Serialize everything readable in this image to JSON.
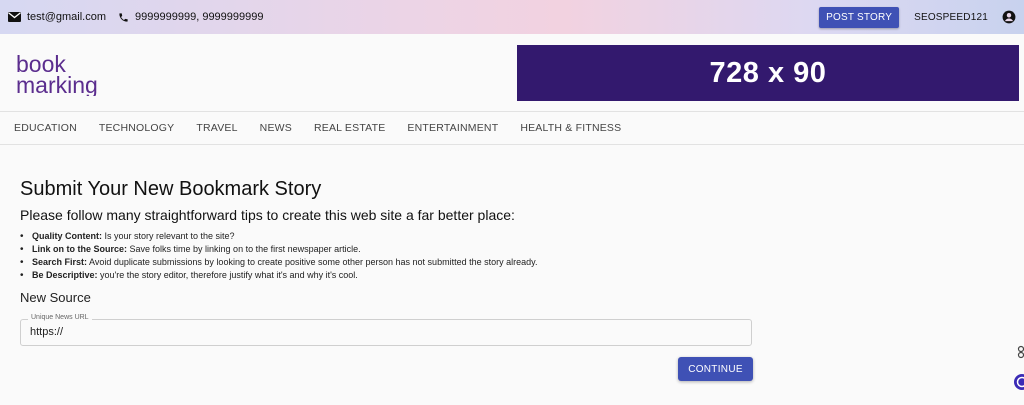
{
  "topbar": {
    "email": "test@gmail.com",
    "phones": "9999999999, 9999999999",
    "post_story_label": "POST STORY",
    "username": "SEOSPEED121"
  },
  "header": {
    "logo_line1": "book",
    "logo_line2": "marking",
    "banner_text": "728 x 90",
    "banner_color": "#33196e"
  },
  "nav": {
    "items": [
      "EDUCATION",
      "TECHNOLOGY",
      "TRAVEL",
      "NEWS",
      "REAL ESTATE",
      "ENTERTAINMENT",
      "HEALTH & FITNESS"
    ]
  },
  "main": {
    "title": "Submit Your New Bookmark Story",
    "subtitle": "Please follow many straightforward tips to create this web site a far better place:",
    "tips": [
      {
        "label": "Quality Content:",
        "text": " Is your story relevant to the site?"
      },
      {
        "label": "Link on to the Source:",
        "text": " Save folks time by linking on to the first newspaper article."
      },
      {
        "label": "Search First:",
        "text": " Avoid duplicate submissions by looking to create positive some other person has not submitted the story already."
      },
      {
        "label": "Be Descriptive:",
        "text": " you're the story editor, therefore justify what it's and why it's cool."
      }
    ],
    "section_label": "New Source",
    "url_field": {
      "legend": "Unique News URL",
      "value": "https://"
    },
    "continue_label": "CONTINUE"
  },
  "colors": {
    "accent": "#3f51b5",
    "logo_purple": "#5b2d8e"
  },
  "icons": [
    "email-icon",
    "phone-icon",
    "account-icon"
  ]
}
